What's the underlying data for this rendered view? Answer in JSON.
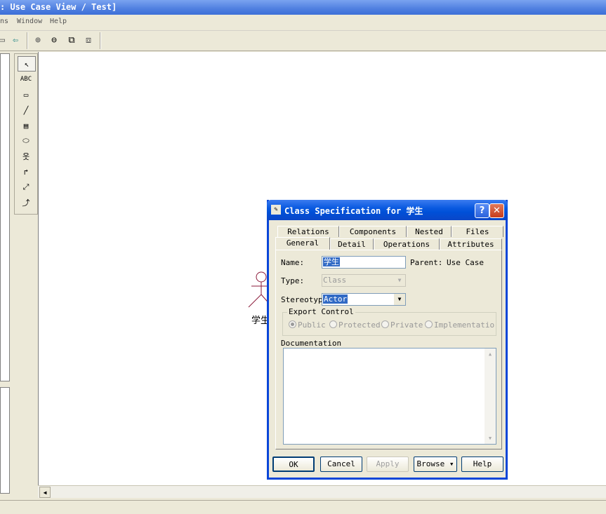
{
  "window": {
    "title": ": Use Case View / Test]"
  },
  "menu": {
    "items": [
      "ns",
      "Window",
      "Help"
    ]
  },
  "canvas": {
    "actor_label": "学生"
  },
  "dialog": {
    "title": "Class Specification for 学生",
    "tabs_row1": [
      "Relations",
      "Components",
      "Nested",
      "Files"
    ],
    "tabs_row2": [
      "General",
      "Detail",
      "Operations",
      "Attributes"
    ],
    "name_label": "Name:",
    "name_value": "学生",
    "parent_label": "Parent:",
    "parent_value": "Use Case",
    "type_label": "Type:",
    "type_value": "Class",
    "stereotype_label": "Stereotype",
    "stereotype_value": "Actor",
    "export_label": "Export Control",
    "export_options": [
      "Public",
      "Protected",
      "Private",
      "Implementatio"
    ],
    "export_selected": "Public",
    "documentation_label": "Documentation",
    "documentation_value": "",
    "buttons": {
      "ok": "OK",
      "cancel": "Cancel",
      "apply": "Apply",
      "browse": "Browse",
      "help": "Help"
    }
  },
  "colors": {
    "title_blue": "#0a46d8",
    "selection": "#316ac5",
    "actor": "#8b1a3a"
  }
}
